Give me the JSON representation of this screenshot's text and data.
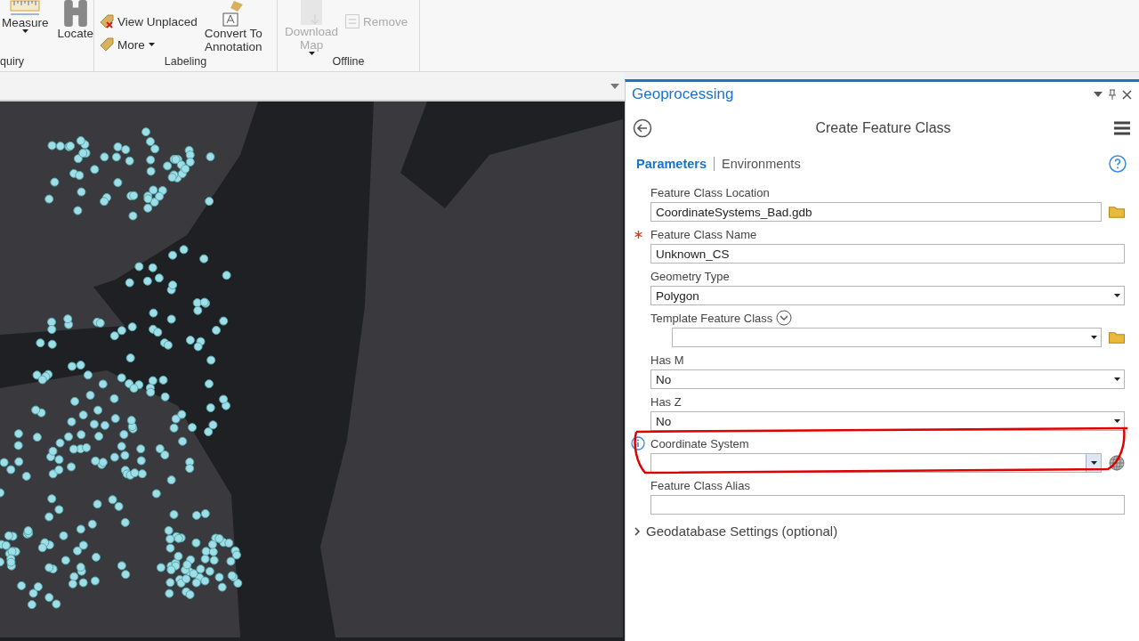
{
  "ribbon": {
    "groups": [
      {
        "label": "quiry",
        "items": [
          {
            "label": "Measure",
            "kind": "large",
            "dropdown": true
          },
          {
            "label": "Locate",
            "kind": "large"
          }
        ]
      },
      {
        "label": "Labeling",
        "items": [
          {
            "label": "View Unplaced",
            "kind": "small"
          },
          {
            "label": "More",
            "kind": "small",
            "dropdown": true
          },
          {
            "label": "Convert To Annotation",
            "kind": "large"
          }
        ]
      },
      {
        "label": "Offline",
        "items": [
          {
            "label": "Download Map",
            "kind": "large",
            "dropdown": true,
            "disabled": true
          },
          {
            "label": "Remove",
            "kind": "small",
            "disabled": true
          }
        ]
      }
    ]
  },
  "pane": {
    "title": "Geoprocessing",
    "tool_title": "Create Feature Class",
    "tabs": [
      {
        "label": "Parameters",
        "selected": true
      },
      {
        "label": "Environments",
        "selected": false
      }
    ],
    "parameters": [
      {
        "label": "Feature Class Location",
        "value": "CoordinateSystems_Bad.gdb",
        "kind": "text",
        "folder": true
      },
      {
        "label": "Feature Class Name",
        "value": "Unknown_CS",
        "kind": "text",
        "required": true
      },
      {
        "label": "Geometry Type",
        "value": "Polygon",
        "kind": "dropdown"
      },
      {
        "label": "Template Feature Class",
        "kind": "dropdown",
        "folder": true,
        "expander": true
      },
      {
        "label": "Has M",
        "value": "No",
        "kind": "dropdown"
      },
      {
        "label": "Has Z",
        "value": "No",
        "kind": "dropdown"
      },
      {
        "label": "Coordinate System",
        "kind": "dropdown",
        "info": true,
        "globe": true,
        "highlighted": true
      },
      {
        "label": "Feature Class Alias",
        "kind": "text"
      }
    ],
    "section": {
      "label": "Geodatabase Settings (optional)",
      "expanded": false
    }
  }
}
